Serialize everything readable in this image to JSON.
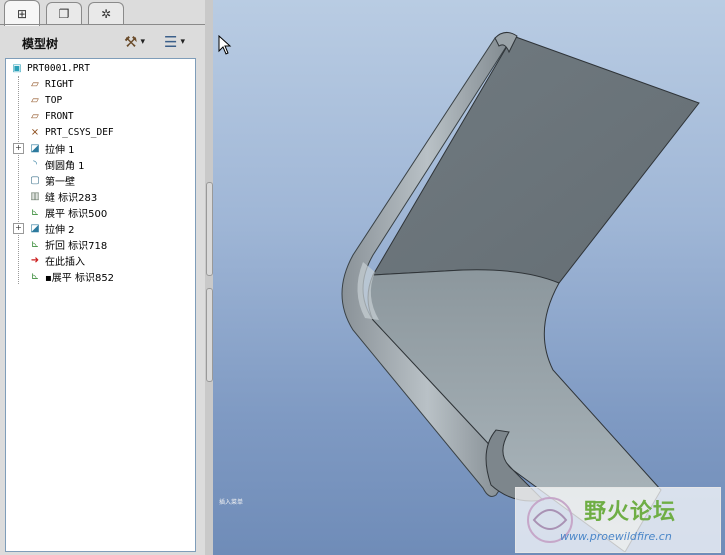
{
  "tabs": [
    {
      "name": "model-tree",
      "icon": "model-tree-icon",
      "symbol": "⊞",
      "active": true
    },
    {
      "name": "folder-browser",
      "icon": "folder-icon",
      "symbol": "❐",
      "active": false
    },
    {
      "name": "favorites",
      "icon": "favorites-icon",
      "symbol": "✲",
      "active": false
    }
  ],
  "panel": {
    "title": "模型树"
  },
  "toolbar": {
    "settings": {
      "icon": "tools-icon",
      "symbol": "⚒",
      "caret": "▾"
    },
    "show": {
      "icon": "list-icon",
      "symbol": "☰",
      "caret": "▾"
    }
  },
  "tree": [
    {
      "label": "PRT0001.PRT",
      "icon": "part-icon",
      "symbol": "▣",
      "indent": 0,
      "expander": null,
      "mono": true
    },
    {
      "label": "RIGHT",
      "icon": "datum-plane-icon",
      "symbol": "▱",
      "indent": 1,
      "expander": null,
      "mono": true
    },
    {
      "label": "TOP",
      "icon": "datum-plane-icon",
      "symbol": "▱",
      "indent": 1,
      "expander": null,
      "mono": true
    },
    {
      "label": "FRONT",
      "icon": "datum-plane-icon",
      "symbol": "▱",
      "indent": 1,
      "expander": null,
      "mono": true
    },
    {
      "label": "PRT_CSYS_DEF",
      "icon": "coordinate-system-icon",
      "symbol": "⨯",
      "indent": 1,
      "expander": null,
      "mono": true
    },
    {
      "label": "拉伸 1",
      "icon": "extrude-icon",
      "symbol": "◪",
      "indent": 1,
      "expander": "+",
      "mono": false
    },
    {
      "label": "倒圆角 1",
      "icon": "round-icon",
      "symbol": "◝",
      "indent": 1,
      "expander": null,
      "mono": false
    },
    {
      "label": "第一壁",
      "icon": "wall-icon",
      "symbol": "▢",
      "indent": 1,
      "expander": null,
      "mono": false
    },
    {
      "label": "缝 标识283",
      "icon": "rip-icon",
      "symbol": "▥",
      "indent": 1,
      "expander": null,
      "mono": false
    },
    {
      "label": "展平 标识500",
      "icon": "unbend-icon",
      "symbol": "⊾",
      "indent": 1,
      "expander": null,
      "mono": false
    },
    {
      "label": "拉伸 2",
      "icon": "extrude-icon",
      "symbol": "◪",
      "indent": 1,
      "expander": "+",
      "mono": false
    },
    {
      "label": "折回 标识718",
      "icon": "bend-back-icon",
      "symbol": "⊾",
      "indent": 1,
      "expander": null,
      "mono": false
    },
    {
      "label": "在此插入",
      "icon": "insert-here-icon",
      "symbol": "➜",
      "indent": 1,
      "expander": null,
      "mono": false
    },
    {
      "label": "▪展平 标识852",
      "icon": "unbend-icon",
      "symbol": "⊾",
      "indent": 1,
      "expander": null,
      "mono": false
    }
  ],
  "viewport": {
    "status_text": "插入菜单"
  },
  "watermark": {
    "text": "野火论坛",
    "url": "www.proewildfire.cn"
  },
  "colors": {
    "part_face": "#6c7479",
    "part_edge": "#2f3438",
    "insert_arrow": "#cc1f1f",
    "plane_icon": "#8a4a18",
    "feature_icon": "#2c7a9e"
  }
}
